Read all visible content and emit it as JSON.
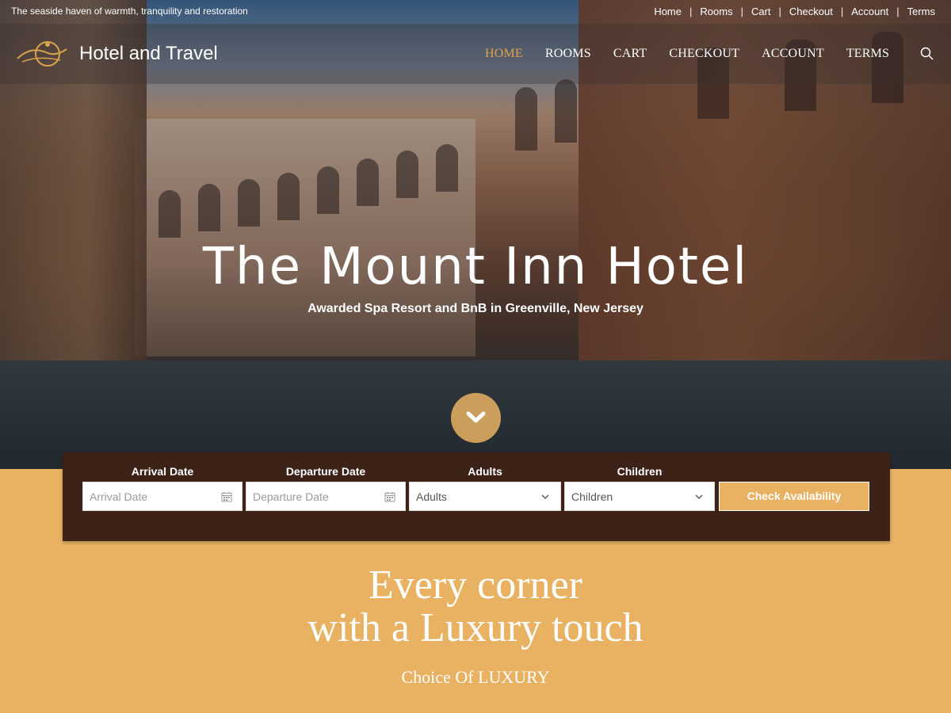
{
  "topbar": {
    "tagline": "The seaside haven of warmth, tranquility and restoration",
    "links": [
      "Home",
      "Rooms",
      "Cart",
      "Checkout",
      "Account",
      "Terms"
    ]
  },
  "header": {
    "site_title": "Hotel and Travel",
    "nav": [
      "HOME",
      "ROOMS",
      "CART",
      "CHECKOUT",
      "ACCOUNT",
      "TERMS"
    ],
    "active_nav": "HOME",
    "search_icon": "search-icon"
  },
  "hero": {
    "title": "The Mount Inn Hotel",
    "subtitle": "Awarded Spa Resort and BnB in Greenville, New Jersey",
    "scroll_icon": "chevron-down-icon"
  },
  "booking": {
    "arrival_label": "Arrival Date",
    "arrival_placeholder": "Arrival Date",
    "departure_label": "Departure Date",
    "departure_placeholder": "Departure Date",
    "adults_label": "Adults",
    "adults_value": "Adults",
    "children_label": "Children",
    "children_value": "Children",
    "check_button": "Check Availability"
  },
  "luxury": {
    "title_line1": "Every corner",
    "title_line2": "with a Luxury touch",
    "subtitle": "Choice Of LUXURY"
  },
  "colors": {
    "accent": "#e8b262",
    "booking_bg": "#3d2218",
    "active_nav": "#e0a24a"
  }
}
